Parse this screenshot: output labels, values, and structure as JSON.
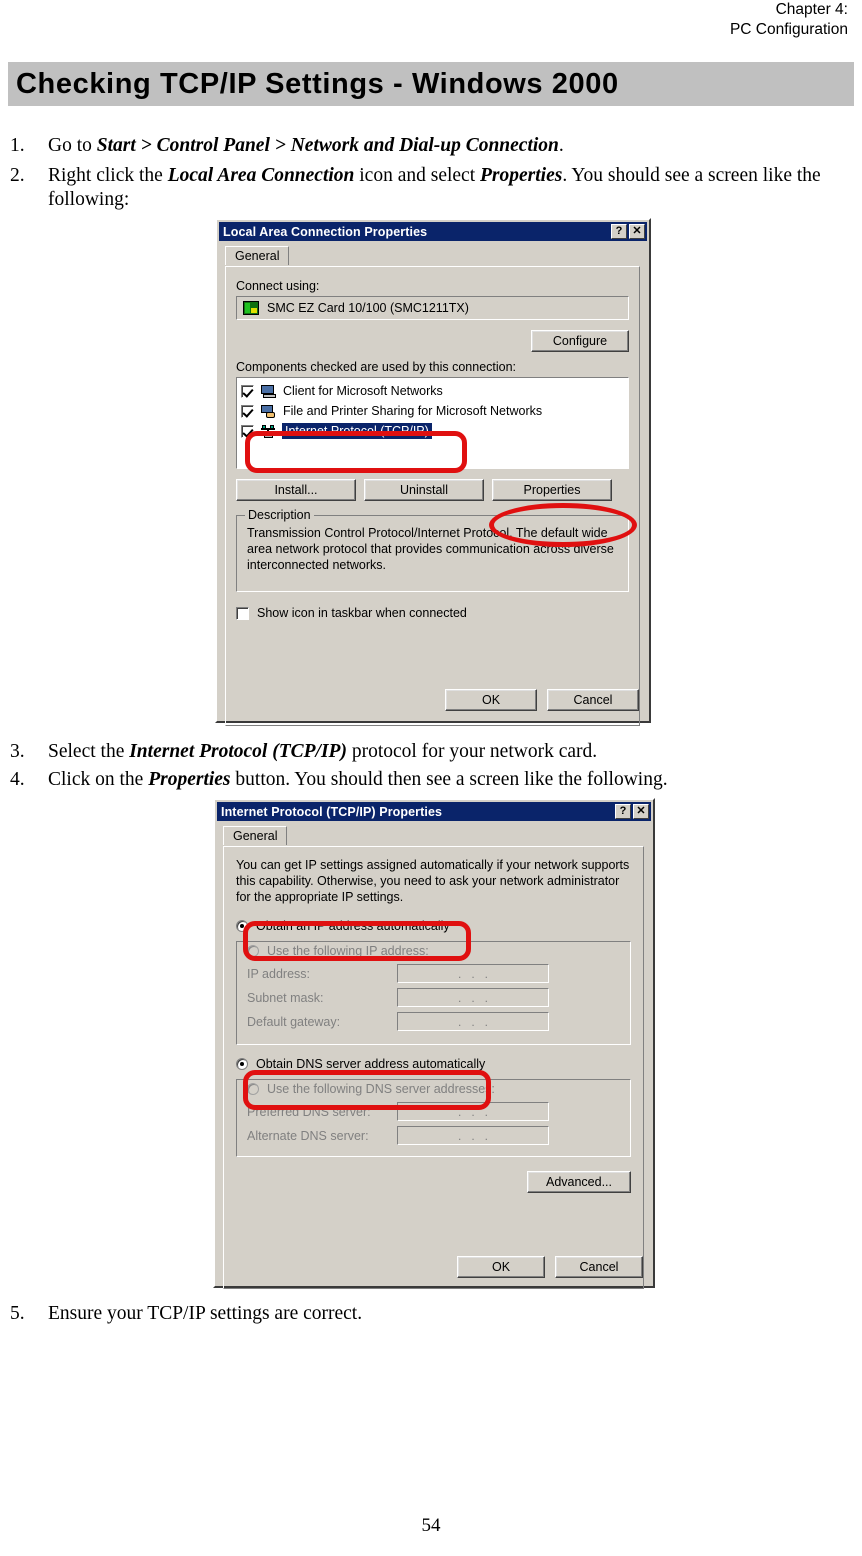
{
  "header": {
    "line1": "Chapter 4:",
    "line2": "PC Configuration"
  },
  "banner": {
    "title": "Checking TCP/IP Settings - Windows 2000"
  },
  "page_number": "54",
  "steps": [
    {
      "num": "1.",
      "segments": [
        {
          "t": "Go to ",
          "style": "normal"
        },
        {
          "t": "Start > Control Panel > Network and Dial-up Connection",
          "style": "bolditalic"
        },
        {
          "t": ".",
          "style": "normal"
        }
      ]
    },
    {
      "num": "2.",
      "segments": [
        {
          "t": "Right click the ",
          "style": "normal"
        },
        {
          "t": "Local Area Connection",
          "style": "bolditalic"
        },
        {
          "t": " icon and select ",
          "style": "normal"
        },
        {
          "t": "Properties",
          "style": "bolditalic"
        },
        {
          "t": ". You should see a screen like the following:",
          "style": "normal"
        }
      ]
    },
    {
      "num": "3.",
      "segments": [
        {
          "t": "Select the ",
          "style": "normal"
        },
        {
          "t": "Internet Protocol (TCP/IP)",
          "style": "bolditalic"
        },
        {
          "t": " protocol for your network card.",
          "style": "normal"
        }
      ]
    },
    {
      "num": "4.",
      "segments": [
        {
          "t": "Click on the ",
          "style": "normal"
        },
        {
          "t": "Properties",
          "style": "bolditalic"
        },
        {
          "t": " button. You should then see a screen like the following.",
          "style": "normal"
        }
      ]
    },
    {
      "num": "5.",
      "segments": [
        {
          "t": "Ensure your TCP/IP settings are correct.",
          "style": "normal"
        }
      ]
    }
  ],
  "dialog1": {
    "title": "Local Area Connection Properties",
    "help_button": "?",
    "close_button": "✕",
    "tab": "General",
    "connect_using_label": "Connect using:",
    "adapter": "SMC EZ Card 10/100 (SMC1211TX)",
    "configure_button": "Configure",
    "components_label": "Components checked are used by this connection:",
    "components": [
      {
        "label": "Client for Microsoft Networks",
        "checked": true,
        "selected": false,
        "icon": "computer-icon"
      },
      {
        "label": "File and Printer Sharing for Microsoft Networks",
        "checked": true,
        "selected": false,
        "icon": "share-icon"
      },
      {
        "label": "Internet Protocol (TCP/IP)",
        "checked": true,
        "selected": true,
        "icon": "protocol-icon"
      }
    ],
    "install_button": "Install...",
    "uninstall_button": "Uninstall",
    "properties_button": "Properties",
    "description_group": "Description",
    "description_text": "Transmission Control Protocol/Internet Protocol. The default wide area network protocol that provides communication across diverse interconnected networks.",
    "show_icon_checkbox": "Show icon in taskbar when connected",
    "show_icon_checked": false,
    "ok_button": "OK",
    "cancel_button": "Cancel"
  },
  "dialog2": {
    "title": "Internet Protocol (TCP/IP) Properties",
    "help_button": "?",
    "close_button": "✕",
    "tab": "General",
    "intro_text": "You can get IP settings assigned automatically if your network supports this capability. Otherwise, you need to ask your network administrator for the appropriate IP settings.",
    "radio_auto_ip": "Obtain an IP address automatically",
    "radio_auto_ip_selected": true,
    "radio_manual_ip": "Use the following IP address:",
    "radio_manual_ip_selected": false,
    "ip_address_label": "IP address:",
    "ip_address_value": "",
    "subnet_mask_label": "Subnet mask:",
    "subnet_mask_value": "",
    "default_gateway_label": "Default gateway:",
    "default_gateway_value": "",
    "radio_auto_dns": "Obtain DNS server address automatically",
    "radio_auto_dns_selected": true,
    "radio_manual_dns": "Use the following DNS server addresses:",
    "radio_manual_dns_selected": false,
    "preferred_dns_label": "Preferred DNS server:",
    "preferred_dns_value": "",
    "alternate_dns_label": "Alternate DNS server:",
    "alternate_dns_value": "",
    "advanced_button": "Advanced...",
    "ok_button": "OK",
    "cancel_button": "Cancel"
  },
  "colors": {
    "banner_bg": "#c0c0c0",
    "dialog_face": "#d4d0c8",
    "titlebar": "#0a246a",
    "selection": "#0a246a",
    "annotation_red": "#e01010"
  }
}
